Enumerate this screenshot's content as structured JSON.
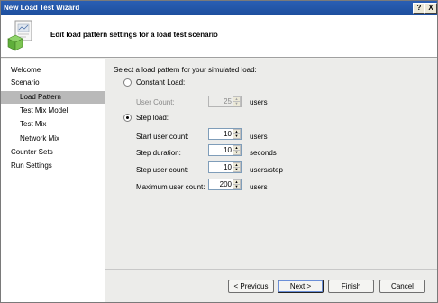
{
  "window": {
    "title": "New Load Test Wizard",
    "help_label": "?",
    "close_label": "X"
  },
  "header": {
    "title": "Edit load pattern settings for a load test scenario",
    "icon": "load-test-wizard-icon"
  },
  "sidebar": {
    "items": [
      {
        "label": "Welcome"
      },
      {
        "label": "Scenario"
      },
      {
        "label": "Load Pattern"
      },
      {
        "label": "Test Mix Model"
      },
      {
        "label": "Test Mix"
      },
      {
        "label": "Network Mix"
      },
      {
        "label": "Counter Sets"
      },
      {
        "label": "Run Settings"
      }
    ],
    "active_index": 2
  },
  "main": {
    "prompt": "Select a load pattern for your simulated load:",
    "constant": {
      "label": "Constant Load:",
      "selected": false,
      "user_count_label": "User Count:",
      "user_count_value": "25",
      "user_count_unit": "users"
    },
    "step": {
      "label": "Step load:",
      "selected": true,
      "start_label": "Start user count:",
      "start_value": "10",
      "start_unit": "users",
      "duration_label": "Step duration:",
      "duration_value": "10",
      "duration_unit": "seconds",
      "step_label": "Step user count:",
      "step_value": "10",
      "step_unit": "users/step",
      "max_label": "Maximum user count:",
      "max_value": "200",
      "max_unit": "users"
    }
  },
  "footer": {
    "previous": "< Previous",
    "next": "Next >",
    "finish": "Finish",
    "cancel": "Cancel"
  }
}
